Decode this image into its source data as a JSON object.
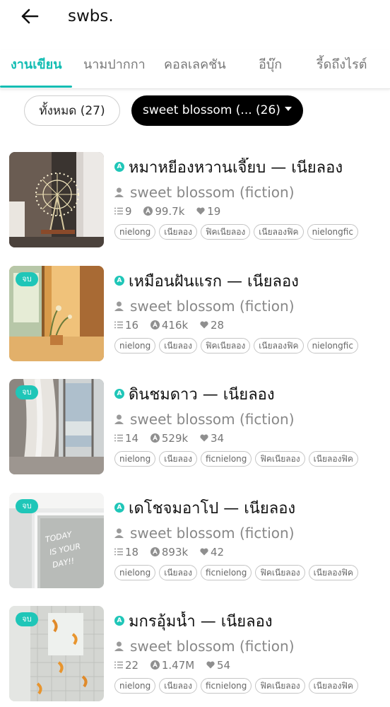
{
  "header": {
    "title": "swbs.",
    "back_icon": "arrow-left-icon"
  },
  "tabs": [
    {
      "label": "งานเขียน",
      "active": true
    },
    {
      "label": "นามปากกา",
      "active": false
    },
    {
      "label": "คอลเลคชัน",
      "active": false
    },
    {
      "label": "อีบุ๊ก",
      "active": false
    },
    {
      "label": "รี้ดถึงไรต์",
      "active": false
    }
  ],
  "filters": {
    "all_label": "ทั้งหมด (27)",
    "selected_label": "sweet blossom (... (26)"
  },
  "colors": {
    "accent": "#13bdb3",
    "badge": "#1fc6b8"
  },
  "stories": [
    {
      "title": "หมาหยีองหวานเจี๊ยบ — เนียลอง",
      "author": "sweet blossom (fiction)",
      "chapters": "9",
      "views": "99.7k",
      "likes": "19",
      "completed": false,
      "badge": "",
      "tags": [
        "nielong",
        "เนียลอง",
        "ฟิคเนียลอง",
        "เนียลองฟิค",
        "nielongfic"
      ]
    },
    {
      "title": "เหมือนฝันแรก — เนียลอง",
      "author": "sweet blossom (fiction)",
      "chapters": "16",
      "views": "416k",
      "likes": "28",
      "completed": true,
      "badge": "จบ",
      "tags": [
        "nielong",
        "เนียลอง",
        "ฟิคเนียลอง",
        "เนียลองฟิค",
        "nielongfic"
      ]
    },
    {
      "title": "ดินชมดาว — เนียลอง",
      "author": "sweet blossom (fiction)",
      "chapters": "14",
      "views": "529k",
      "likes": "34",
      "completed": true,
      "badge": "จบ",
      "tags": [
        "nielong",
        "เนียลอง",
        "ficnielong",
        "ฟิคเนียลอง",
        "เนียลองฟิค"
      ]
    },
    {
      "title": "เดโชจมอาโป — เนียลอง",
      "author": "sweet blossom (fiction)",
      "chapters": "18",
      "views": "893k",
      "likes": "42",
      "completed": true,
      "badge": "จบ",
      "tags": [
        "nielong",
        "เนียลอง",
        "ficnielong",
        "ฟิคเนียลอง",
        "เนียลองฟิค"
      ]
    },
    {
      "title": "มกรอุ้มน้ำ — เนียลอง",
      "author": "sweet blossom (fiction)",
      "chapters": "22",
      "views": "1.47M",
      "likes": "54",
      "completed": true,
      "badge": "จบ",
      "tags": [
        "nielong",
        "เนียลอง",
        "ficnielong",
        "ฟิคเนียลอง",
        "เนียลองฟิค"
      ]
    }
  ]
}
